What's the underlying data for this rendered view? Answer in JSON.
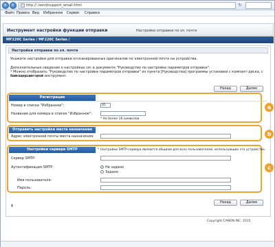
{
  "browser": {
    "url": "http://                /send/support_email.html",
    "menu": [
      "Файл",
      "Правка",
      "Вид",
      "Избранное",
      "Сервис",
      "Справка"
    ]
  },
  "header": {
    "title": "Инструмент настройки функции отправки",
    "subtitle": "Настройки отправки по эл. почте"
  },
  "brand": "MF220C Series / MF220C Series /",
  "section": {
    "title": "Настройки отправки по эл. почте",
    "desc1": "Укажите настройки для отправки отсканированных оригиналов по электронной почте на устройства.",
    "desc2": "Дополнительные сведения о настройках см. в документе \"Руководство по настройке параметров отправки\".",
    "desc3": "* Можно отобразить \"Руководство по настройке параметров отправки\" из пункта [Руководства] программы установки с компакт-диска, с помощью которой",
    "desc4": "был запущен этот инструмент."
  },
  "buttons": {
    "back": "Назад",
    "next": "Далее"
  },
  "registration": {
    "badge": "a",
    "heading": "Регистрация",
    "number_label": "Номер в списке \"Избранное\":",
    "number_value": "05",
    "name_label": "Название для номера в списке \"Избранное\":",
    "name_value": "",
    "name_note": "* Не более 16 символов"
  },
  "destination": {
    "badge": "b",
    "heading": "Отправить настройки места назначения",
    "email_label": "Адрес электронной почты места назначения:",
    "email_value": ""
  },
  "smtp": {
    "badge": "c",
    "heading": "Настройки сервера SMTP",
    "note": "* Настройки SMTP-сервера являются общими для всех пользователей, использующих это устройство.",
    "server_label": "Сервер SMTP:",
    "server_value": "",
    "auth_label": "Аутентификация SMTP:",
    "auth_opt1": "Не задано",
    "auth_opt2": "Задано",
    "user_label": "Имя пользователя:",
    "password_label": "Пароль:"
  },
  "copyright": "Copyright CANON INC. 2015"
}
